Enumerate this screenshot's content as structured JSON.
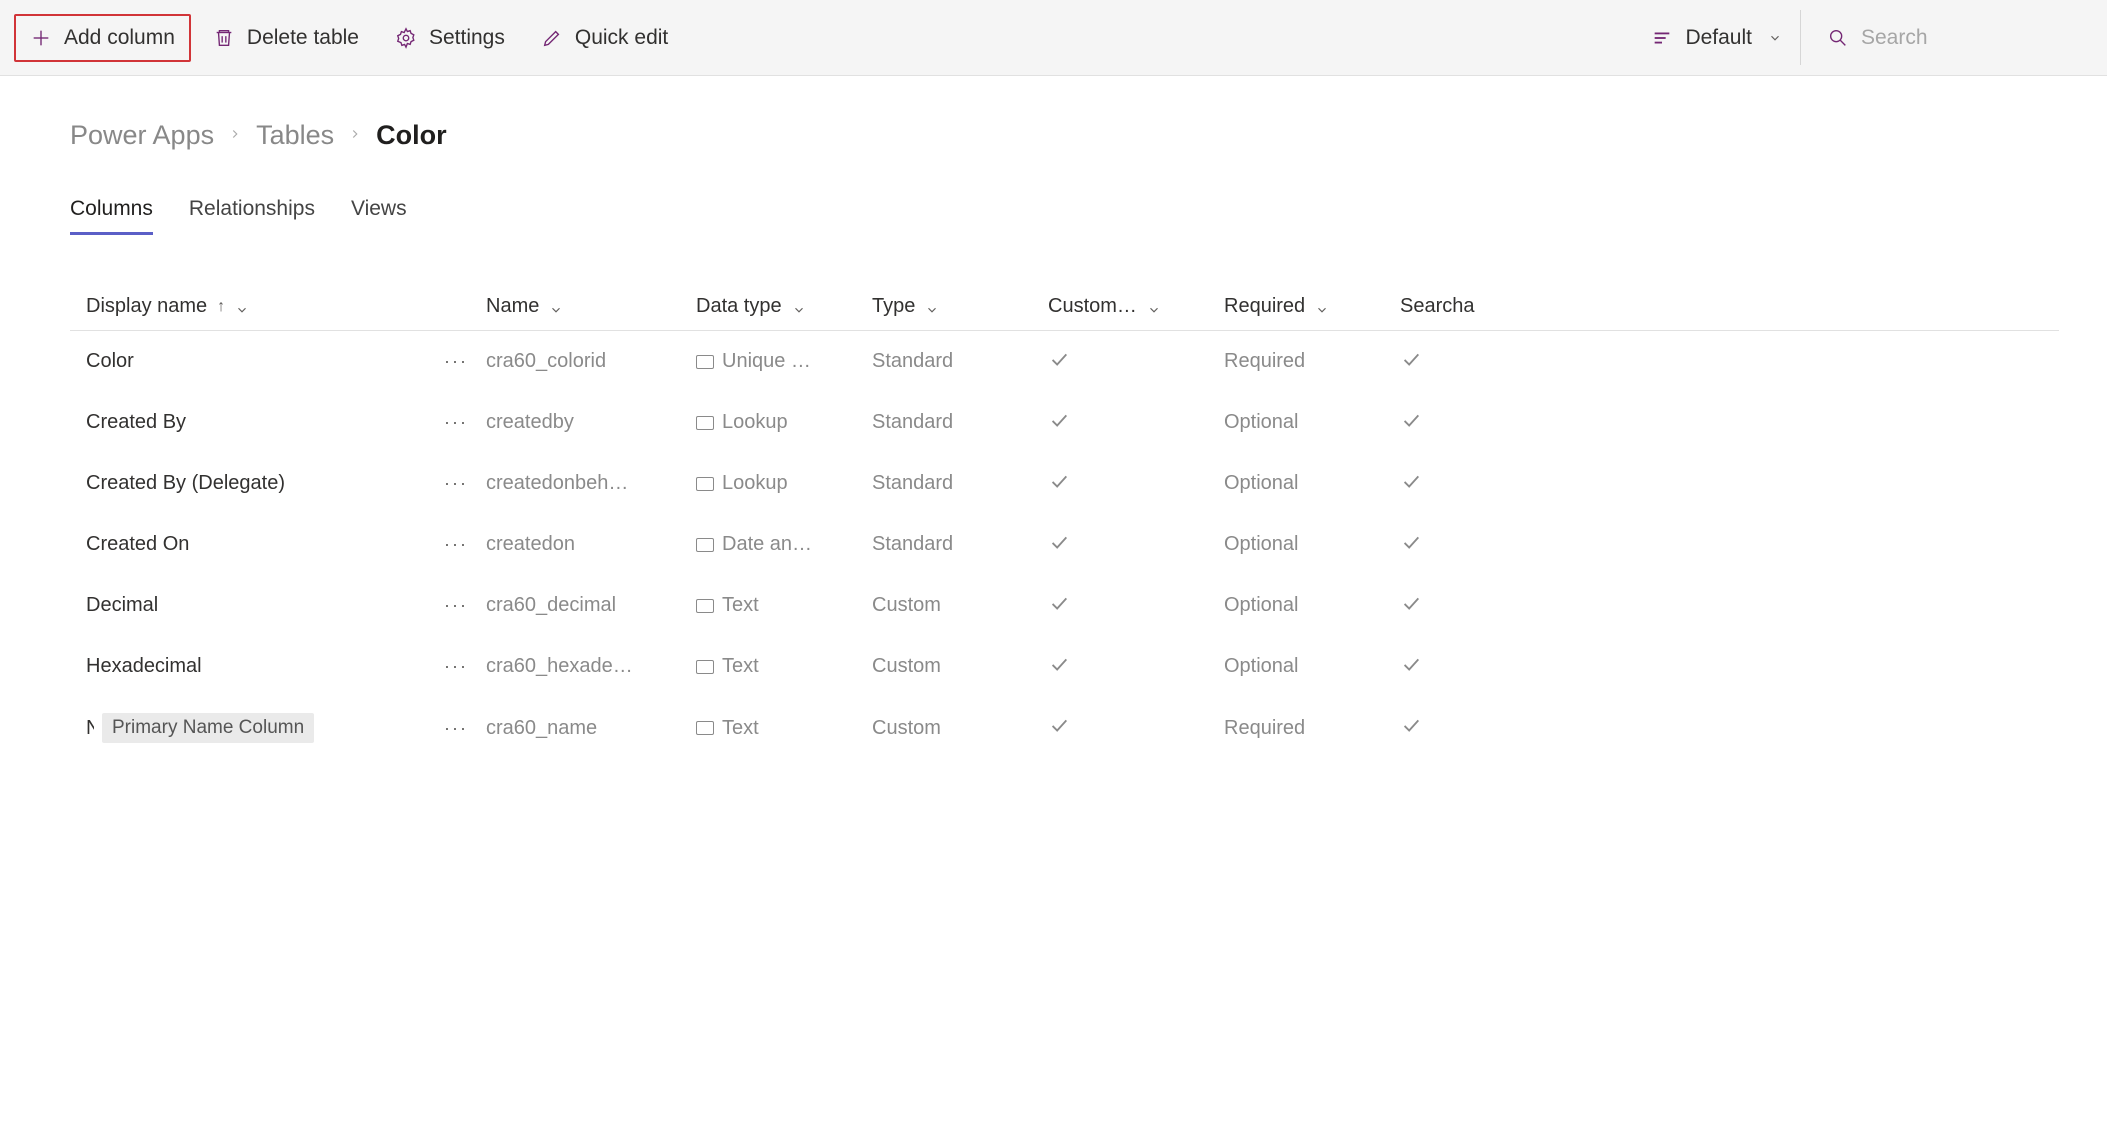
{
  "toolbar": {
    "add_column": "Add column",
    "delete_table": "Delete table",
    "settings": "Settings",
    "quick_edit": "Quick edit",
    "view_label": "Default",
    "search_placeholder": "Search"
  },
  "breadcrumb": {
    "root": "Power Apps",
    "tables": "Tables",
    "current": "Color"
  },
  "tabs": {
    "columns": "Columns",
    "relationships": "Relationships",
    "views": "Views"
  },
  "headers": {
    "display_name": "Display name",
    "name": "Name",
    "data_type": "Data type",
    "type": "Type",
    "custom": "Custom…",
    "required": "Required",
    "searchable": "Searcha"
  },
  "rows": [
    {
      "display": "Color",
      "name": "cra60_colorid",
      "dtype": "Unique …",
      "type": "Standard",
      "custom": true,
      "required": "Required",
      "searchable": true,
      "badge": ""
    },
    {
      "display": "Created By",
      "name": "createdby",
      "dtype": "Lookup",
      "type": "Standard",
      "custom": true,
      "required": "Optional",
      "searchable": true,
      "badge": ""
    },
    {
      "display": "Created By (Delegate)",
      "name": "createdonbeh…",
      "dtype": "Lookup",
      "type": "Standard",
      "custom": true,
      "required": "Optional",
      "searchable": true,
      "badge": ""
    },
    {
      "display": "Created On",
      "name": "createdon",
      "dtype": "Date an…",
      "type": "Standard",
      "custom": true,
      "required": "Optional",
      "searchable": true,
      "badge": ""
    },
    {
      "display": "Decimal",
      "name": "cra60_decimal",
      "dtype": "Text",
      "type": "Custom",
      "custom": true,
      "required": "Optional",
      "searchable": true,
      "badge": ""
    },
    {
      "display": "Hexadecimal",
      "name": "cra60_hexade…",
      "dtype": "Text",
      "type": "Custom",
      "custom": true,
      "required": "Optional",
      "searchable": true,
      "badge": ""
    },
    {
      "display": "N",
      "name": "cra60_name",
      "dtype": "Text",
      "type": "Custom",
      "custom": true,
      "required": "Required",
      "searchable": true,
      "badge": "Primary Name Column"
    }
  ]
}
